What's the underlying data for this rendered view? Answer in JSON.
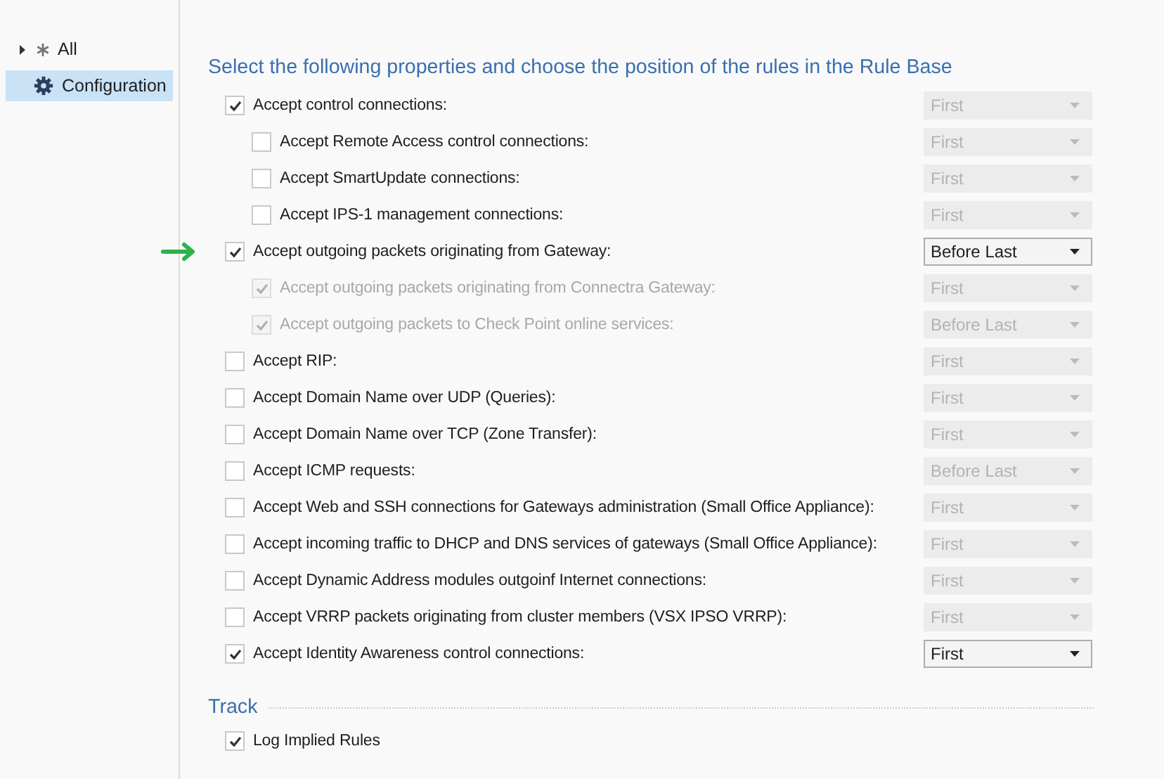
{
  "sidebar": {
    "items": [
      {
        "label": "All",
        "expandable": true,
        "selected": false
      },
      {
        "label": "Configuration",
        "expandable": false,
        "selected": true
      }
    ]
  },
  "heading": "Select the following properties and choose the position of the rules in the Rule Base",
  "rules": [
    {
      "label": "Accept control connections:",
      "checked": true,
      "disabled": false,
      "arrow": false,
      "position": "First",
      "position_disabled": true,
      "children": [
        {
          "label": "Accept Remote Access control connections:",
          "checked": false,
          "disabled": false,
          "arrow": false,
          "position": "First",
          "position_disabled": true
        },
        {
          "label": "Accept SmartUpdate connections:",
          "checked": false,
          "disabled": false,
          "arrow": false,
          "position": "First",
          "position_disabled": true
        },
        {
          "label": "Accept IPS-1 management connections:",
          "checked": false,
          "disabled": false,
          "arrow": false,
          "position": "First",
          "position_disabled": true
        }
      ]
    },
    {
      "label": "Accept outgoing packets originating from Gateway:",
      "checked": true,
      "disabled": false,
      "arrow": true,
      "position": "Before Last",
      "position_disabled": false,
      "children": [
        {
          "label": "Accept outgoing packets originating from Connectra Gateway:",
          "checked": true,
          "disabled": true,
          "arrow": false,
          "position": "First",
          "position_disabled": true
        },
        {
          "label": "Accept outgoing packets to Check Point online services:",
          "checked": true,
          "disabled": true,
          "arrow": false,
          "position": "Before Last",
          "position_disabled": true
        }
      ]
    },
    {
      "label": "Accept RIP:",
      "checked": false,
      "disabled": false,
      "arrow": false,
      "position": "First",
      "position_disabled": true
    },
    {
      "label": "Accept Domain Name over UDP (Queries):",
      "checked": false,
      "disabled": false,
      "arrow": false,
      "position": "First",
      "position_disabled": true
    },
    {
      "label": "Accept Domain Name over TCP (Zone Transfer):",
      "checked": false,
      "disabled": false,
      "arrow": false,
      "position": "First",
      "position_disabled": true
    },
    {
      "label": "Accept ICMP requests:",
      "checked": false,
      "disabled": false,
      "arrow": false,
      "position": "Before Last",
      "position_disabled": true
    },
    {
      "label": "Accept Web and SSH connections for Gateways administration (Small Office Appliance):",
      "checked": false,
      "disabled": false,
      "arrow": false,
      "position": "First",
      "position_disabled": true
    },
    {
      "label": "Accept incoming traffic to DHCP and DNS services of gateways (Small Office Appliance):",
      "checked": false,
      "disabled": false,
      "arrow": false,
      "position": "First",
      "position_disabled": true
    },
    {
      "label": "Accept Dynamic Address modules outgoinf Internet connections:",
      "checked": false,
      "disabled": false,
      "arrow": false,
      "position": "First",
      "position_disabled": true
    },
    {
      "label": "Accept VRRP packets originating from cluster members (VSX IPSO VRRP):",
      "checked": false,
      "disabled": false,
      "arrow": false,
      "position": "First",
      "position_disabled": true
    },
    {
      "label": "Accept Identity Awareness control connections:",
      "checked": true,
      "disabled": false,
      "arrow": false,
      "position": "First",
      "position_disabled": false
    }
  ],
  "track": {
    "heading": "Track",
    "items": [
      {
        "label": "Log Implied Rules",
        "checked": true
      }
    ]
  }
}
